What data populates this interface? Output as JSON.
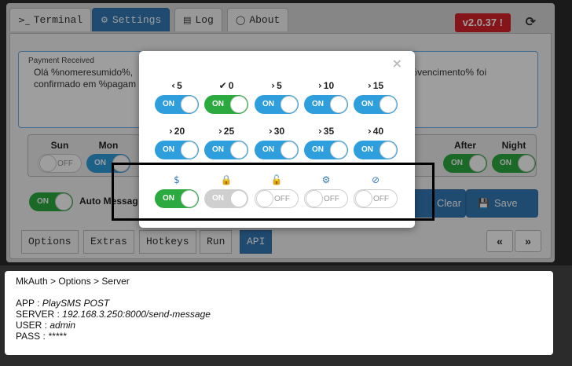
{
  "tabs": [
    {
      "icon": ">_",
      "label": "Terminal"
    },
    {
      "icon": "⚙",
      "label": "Settings"
    },
    {
      "icon": "▤",
      "label": "Log"
    },
    {
      "icon": "◯",
      "label": "About"
    }
  ],
  "version": "v2.0.37 !",
  "refresh_icon": "⟳",
  "message": {
    "title": "Payment Received",
    "line1_left": "Olá %nomeresumido%,",
    "line1_right": "m %vencimento% foi",
    "line2": "confirmado em %pagam"
  },
  "times": [
    {
      "label": "Sun",
      "state": "OFF"
    },
    {
      "label": "Mon",
      "state": "ON"
    },
    {
      "label": "After",
      "state": "ON"
    },
    {
      "label": "Night",
      "state": "ON"
    }
  ],
  "auto": {
    "state": "ON",
    "label": "Auto Messag"
  },
  "buttons": {
    "clear": "Clear",
    "save": "Save"
  },
  "bottom_tabs": [
    "Options",
    "Extras",
    "Hotkeys",
    "Run",
    "API"
  ],
  "pager": {
    "prev": "«",
    "next": "»"
  },
  "modal": {
    "close": "×",
    "row1": [
      {
        "glyph": "‹",
        "label": "5",
        "state": "ON",
        "color": "blue"
      },
      {
        "glyph": "✔",
        "label": "0",
        "state": "ON",
        "color": "green"
      },
      {
        "glyph": "›",
        "label": "5",
        "state": "ON",
        "color": "blue"
      },
      {
        "glyph": "›",
        "label": "10",
        "state": "ON",
        "color": "blue"
      },
      {
        "glyph": "›",
        "label": "15",
        "state": "ON",
        "color": "blue"
      }
    ],
    "row2": [
      {
        "glyph": "›",
        "label": "20",
        "state": "ON",
        "color": "blue"
      },
      {
        "glyph": "›",
        "label": "25",
        "state": "ON",
        "color": "blue"
      },
      {
        "glyph": "›",
        "label": "30",
        "state": "ON",
        "color": "blue"
      },
      {
        "glyph": "›",
        "label": "35",
        "state": "ON",
        "color": "blue"
      },
      {
        "glyph": "›",
        "label": "40",
        "state": "ON",
        "color": "blue"
      }
    ],
    "row3": [
      {
        "icon": "$",
        "icon_name": "dollar-icon",
        "state": "ON",
        "color": "green"
      },
      {
        "icon": "🔒",
        "icon_name": "lock-icon",
        "state": "ON",
        "color": "grey"
      },
      {
        "icon": "🔓",
        "icon_name": "unlock-icon",
        "state": "OFF",
        "color": "white"
      },
      {
        "icon": "⚙",
        "icon_name": "gears-icon",
        "state": "OFF",
        "color": "white"
      },
      {
        "icon": "⊘",
        "icon_name": "ban-icon",
        "state": "OFF",
        "color": "white"
      }
    ]
  },
  "info": {
    "breadcrumb": "MkAuth > Options > Server",
    "lines": [
      {
        "key": "APP : ",
        "value": "PlaySMS POST"
      },
      {
        "key": "SERVER : ",
        "value": "192.168.3.250:8000/send-message"
      },
      {
        "key": "USER : ",
        "value": "admin"
      },
      {
        "key": "PASS : ",
        "value": "*****"
      }
    ]
  }
}
